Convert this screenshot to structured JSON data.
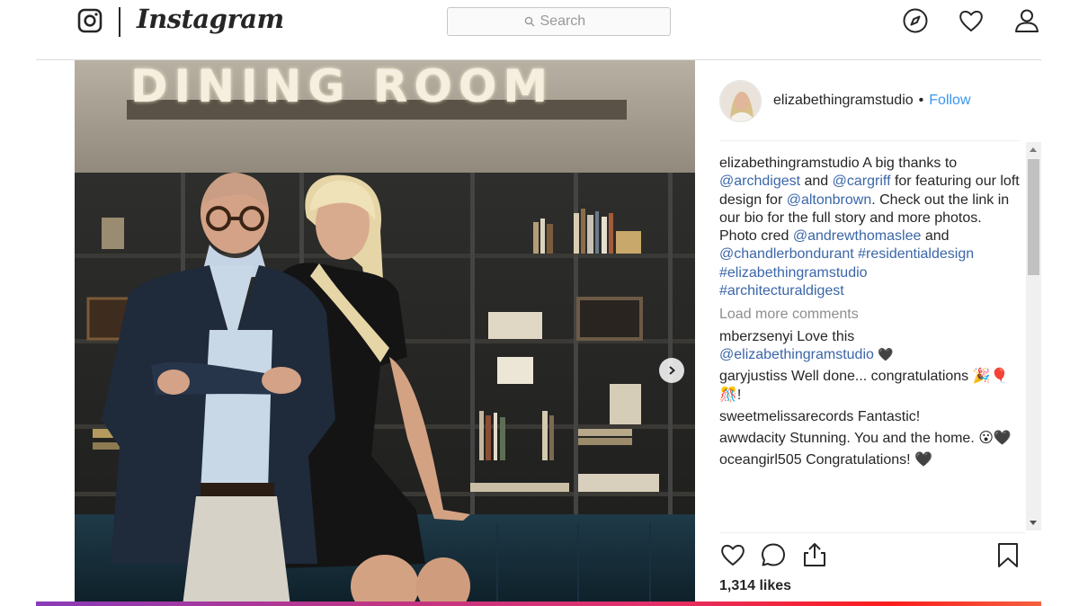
{
  "app": {
    "brand": "Instagram"
  },
  "search": {
    "placeholder": "Search"
  },
  "nav": {
    "icons": [
      "explore-compass-icon",
      "activity-heart-icon",
      "profile-person-icon"
    ]
  },
  "post": {
    "photo_sign": "DINING ROOM",
    "author": "elizabethingramstudio",
    "follow_label": "Follow",
    "caption": {
      "user": "elizabethingramstudio",
      "t1": " A big thanks to ",
      "m1": "@archdigest",
      "t2": " and ",
      "m2": "@cargriff",
      "t3": " for featuring our loft design for ",
      "m3": "@altonbrown",
      "t4": ". Check out the link in our bio for the full story and more photos.",
      "t5": "Photo cred ",
      "m4": "@andrewthomaslee",
      "t6": " and ",
      "m5": "@chandlerbondurant",
      "m6": "#residentialdesign",
      "m7": "#elizabethingramstudio",
      "m8": "#architecturaldigest"
    },
    "load_more": "Load more comments",
    "comments": [
      {
        "user": "mberzsenyi",
        "text": " Love this ",
        "mention": "@elizabethingramstudio",
        "emoji": " 🖤"
      },
      {
        "user": "garyjustiss",
        "text": " Well done... congratulations 🎉🎈🎊!"
      },
      {
        "user": "sweetmelissarecords",
        "text": " Fantastic!"
      },
      {
        "user": "awwdacity",
        "text": " Stunning. You and the home. 😮🖤"
      },
      {
        "user": "oceangirl505",
        "text": " Congratulations! 🖤"
      }
    ],
    "likes": "1,314 likes"
  },
  "colors": {
    "link_blue": "#3897f0",
    "mention_blue": "#3b66a8",
    "muted_gray": "#8e8e8e",
    "text": "#262626"
  }
}
